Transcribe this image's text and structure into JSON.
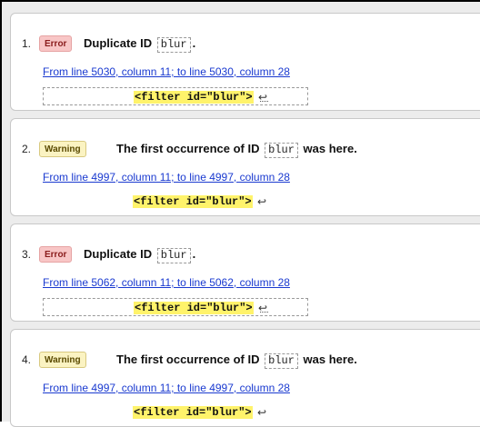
{
  "messages": [
    {
      "number": "1.",
      "type": "Error",
      "title_prefix": "Duplicate ID",
      "title_id": "blur",
      "title_suffix": ".",
      "location": "From line 5030, column 11; to line 5030, column 28",
      "snippet": "<filter id=\"blur\">",
      "return_symbol": "↩"
    },
    {
      "number": "2.",
      "type": "Warning",
      "title_prefix": "The first occurrence of ID",
      "title_id": "blur",
      "title_suffix": "was here.",
      "location": "From line 4997, column 11; to line 4997, column 28",
      "snippet": "<filter id=\"blur\">",
      "return_symbol": "↩"
    },
    {
      "number": "3.",
      "type": "Error",
      "title_prefix": "Duplicate ID",
      "title_id": "blur",
      "title_suffix": ".",
      "location": "From line 5062, column 11; to line 5062, column 28",
      "snippet": "<filter id=\"blur\">",
      "return_symbol": "↩"
    },
    {
      "number": "4.",
      "type": "Warning",
      "title_prefix": "The first occurrence of ID",
      "title_id": "blur",
      "title_suffix": "was here.",
      "location": "From line 4997, column 11; to line 4997, column 28",
      "snippet": "<filter id=\"blur\">",
      "return_symbol": "↩"
    }
  ],
  "colors": {
    "error_badge_bg": "#f8c6c6",
    "warning_badge_bg": "#fbf3c2",
    "link": "#1a3ad0",
    "highlight": "#fff36b"
  }
}
